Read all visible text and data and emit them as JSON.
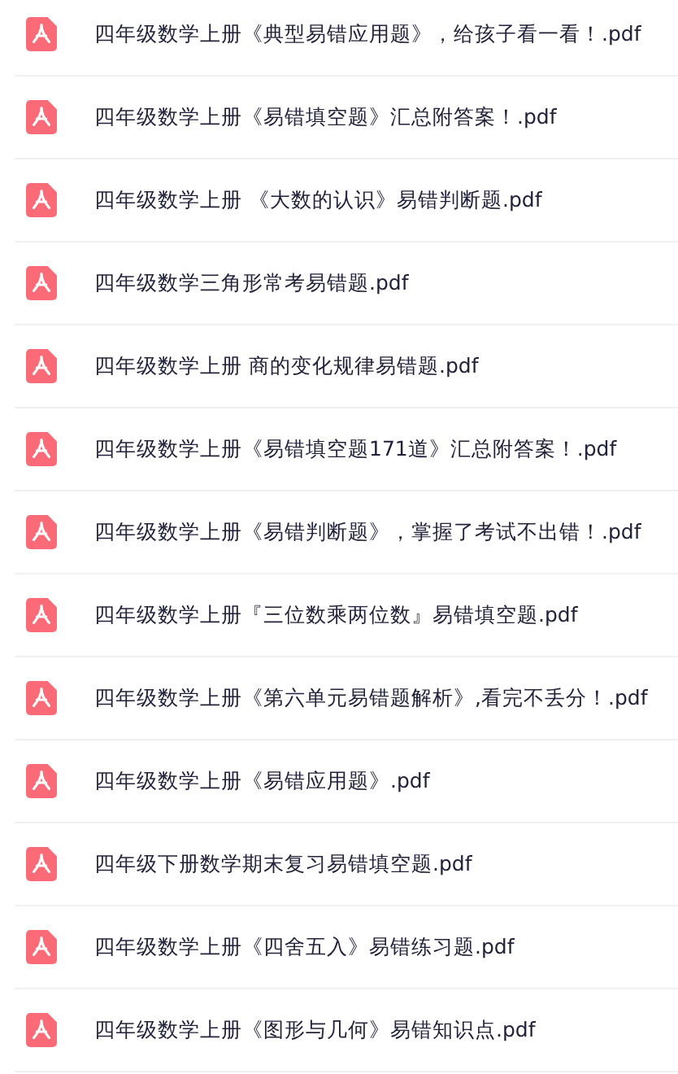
{
  "files": [
    {
      "name": "四年级数学上册《典型易错应用题》，给孩子看一看！.pdf"
    },
    {
      "name": "四年级数学上册《易错填空题》汇总附答案！.pdf"
    },
    {
      "name": "四年级数学上册 《大数的认识》易错判断题.pdf"
    },
    {
      "name": "四年级数学三角形常考易错题.pdf"
    },
    {
      "name": "四年级数学上册 商的变化规律易错题.pdf"
    },
    {
      "name": "四年级数学上册《易错填空题171道》汇总附答案！.pdf"
    },
    {
      "name": "四年级数学上册《易错判断题》，掌握了考试不出错！.pdf"
    },
    {
      "name": "四年级数学上册『三位数乘两位数』易错填空题.pdf"
    },
    {
      "name": "四年级数学上册《第六单元易错题解析》,看完不丢分！.pdf"
    },
    {
      "name": "四年级数学上册《易错应用题》.pdf"
    },
    {
      "name": "四年级下册数学期末复习易错填空题.pdf"
    },
    {
      "name": "四年级数学上册《四舍五入》易错练习题.pdf"
    },
    {
      "name": "四年级数学上册《图形与几何》易错知识点.pdf"
    }
  ]
}
